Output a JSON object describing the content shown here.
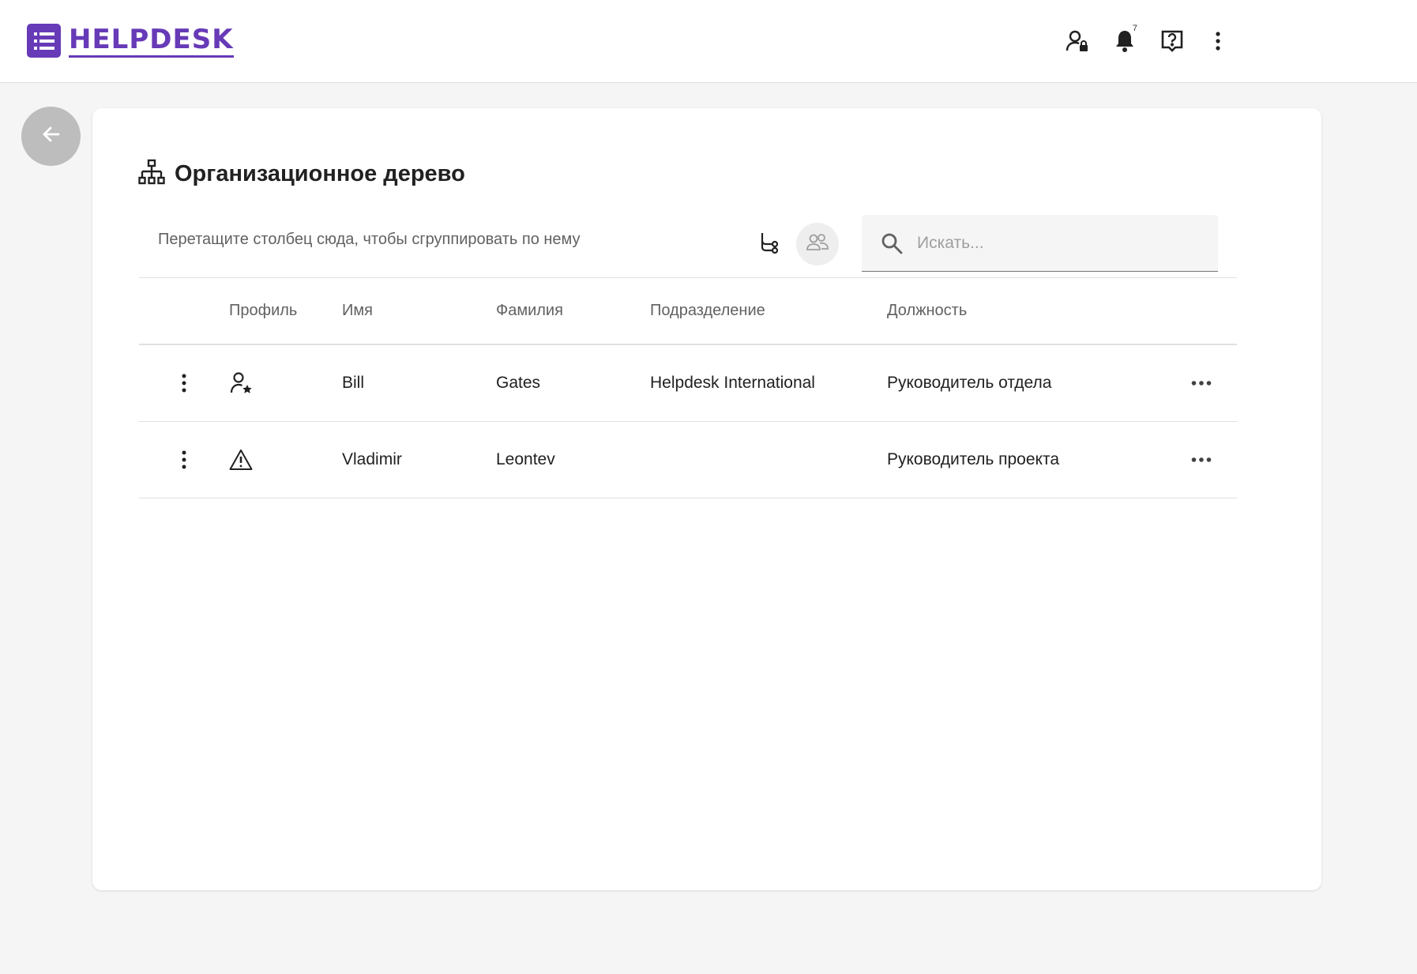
{
  "app": {
    "logo_text": "HELPDESK",
    "accent_color": "#673ab7",
    "notification_count": "7"
  },
  "header_icons": [
    "user-lock-icon",
    "bell-icon",
    "help-icon",
    "more-vert-icon"
  ],
  "page": {
    "title": "Организационное дерево",
    "group_panel_text": "Перетащите столбец сюда, чтобы сгруппировать по нему",
    "search_placeholder": "Искать..."
  },
  "table": {
    "columns": [
      "Профиль",
      "Имя",
      "Фамилия",
      "Подразделение",
      "Должность"
    ],
    "rows": [
      {
        "profile_icon": "user-star-icon",
        "first_name": "Bill",
        "last_name": "Gates",
        "department": "Helpdesk International",
        "position": "Руководитель отдела"
      },
      {
        "profile_icon": "warning-icon",
        "first_name": "Vladimir",
        "last_name": "Leontev",
        "department": "",
        "position": "Руководитель проекта"
      }
    ]
  }
}
